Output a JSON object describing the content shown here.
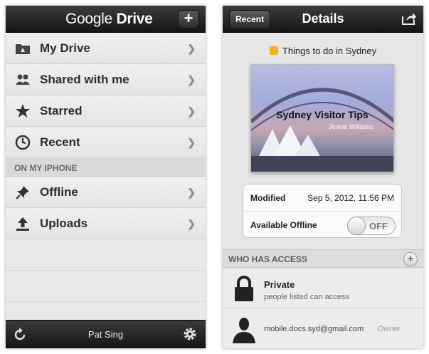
{
  "left": {
    "header": {
      "brand_google": "Google",
      "brand_drive": "Drive",
      "add_button": "+"
    },
    "nav": [
      {
        "label": "My Drive",
        "icon": "drive-icon"
      },
      {
        "label": "Shared with me",
        "icon": "people-icon"
      },
      {
        "label": "Starred",
        "icon": "star-icon"
      },
      {
        "label": "Recent",
        "icon": "clock-icon"
      }
    ],
    "section": "ON MY IPHONE",
    "device_nav": [
      {
        "label": "Offline",
        "icon": "pin-icon"
      },
      {
        "label": "Uploads",
        "icon": "upload-icon"
      }
    ],
    "footer": {
      "user": "Pat Sing"
    }
  },
  "right": {
    "header": {
      "back_label": "Recent",
      "title": "Details"
    },
    "document": {
      "name": "Things to do in Sydney",
      "thumb_title": "Sydney Visitor Tips",
      "thumb_subtitle": "Jennie Williams"
    },
    "info": {
      "modified_label": "Modified",
      "modified_value": "Sep 5, 2012, 11:56 PM",
      "offline_label": "Available Offline",
      "offline_state": "OFF"
    },
    "access": {
      "heading": "WHO HAS ACCESS",
      "add": "+",
      "private_title": "Private",
      "private_desc": "people listed can access",
      "owner_email": "mobile.docs.syd@gmail.com",
      "owner_role": "Owner"
    }
  },
  "colors": {
    "bar_dark": "#1e1e1e",
    "doc_yellow": "#f2b21c",
    "row_bg": "#ebebeb"
  }
}
